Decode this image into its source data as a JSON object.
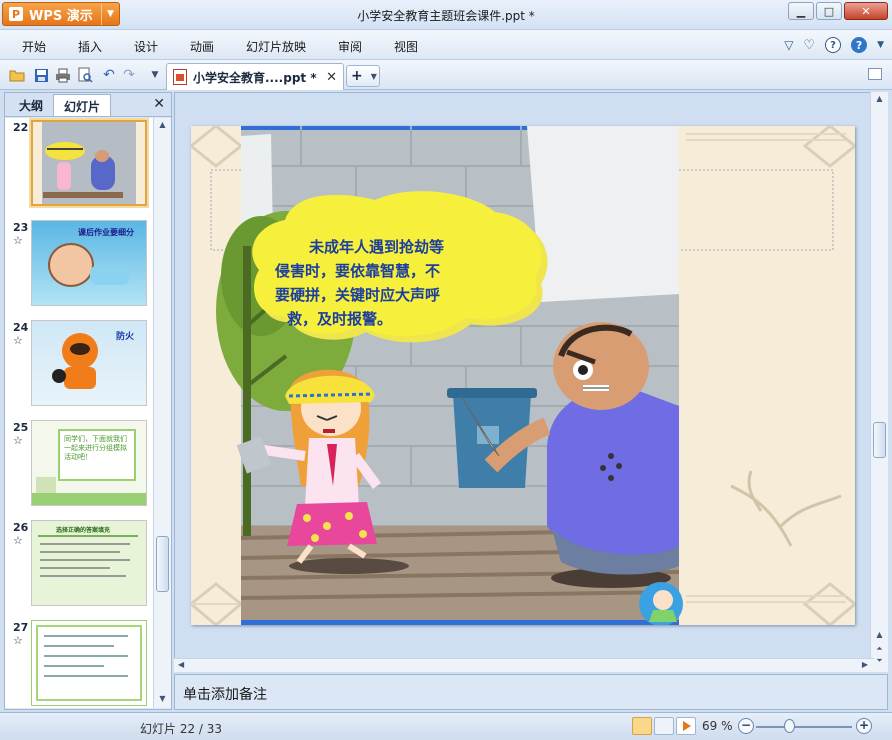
{
  "app": {
    "brand": "WPS 演示",
    "title": "小学安全教育主题班会课件.ppt *"
  },
  "menu": [
    "开始",
    "插入",
    "设计",
    "动画",
    "幻灯片放映",
    "审阅",
    "视图"
  ],
  "toolbar": {
    "icons": [
      "open-folder-icon",
      "save-icon",
      "print-icon",
      "print-preview-icon",
      "undo-icon",
      "redo-icon",
      "customize-dropdown-icon"
    ]
  },
  "tabs": {
    "document_label": "小学安全教育....ppt *",
    "close": "✕",
    "new": "+"
  },
  "left_panel": {
    "tabs": [
      "大纲",
      "幻灯片"
    ],
    "active_tab": "幻灯片",
    "close": "✕",
    "slides": [
      {
        "number": "22",
        "star": false,
        "active": true
      },
      {
        "number": "23",
        "star": true,
        "text": "课后作业要细分"
      },
      {
        "number": "24",
        "star": true,
        "text": "防火"
      },
      {
        "number": "25",
        "star": true,
        "text": "同学们，下面就我们一起来进行分组模拟活动吧！"
      },
      {
        "number": "26",
        "star": true,
        "text": "选择正确的答案填充"
      },
      {
        "number": "27",
        "star": true
      }
    ]
  },
  "slide": {
    "bubble_lines": [
      "未成年人遇到抢劫等",
      "侵害时，要依靠智慧，不",
      "要硬拼，关键时应大声呼",
      "救，及时报警。"
    ]
  },
  "notes": {
    "placeholder": "单击添加备注"
  },
  "status": {
    "slide_position": "幻灯片 22 / 33",
    "zoom": "69 %",
    "zoom_fraction": 0.35
  },
  "colors": {
    "accent_orange": "#e5751a",
    "selection": "#e1a442"
  }
}
